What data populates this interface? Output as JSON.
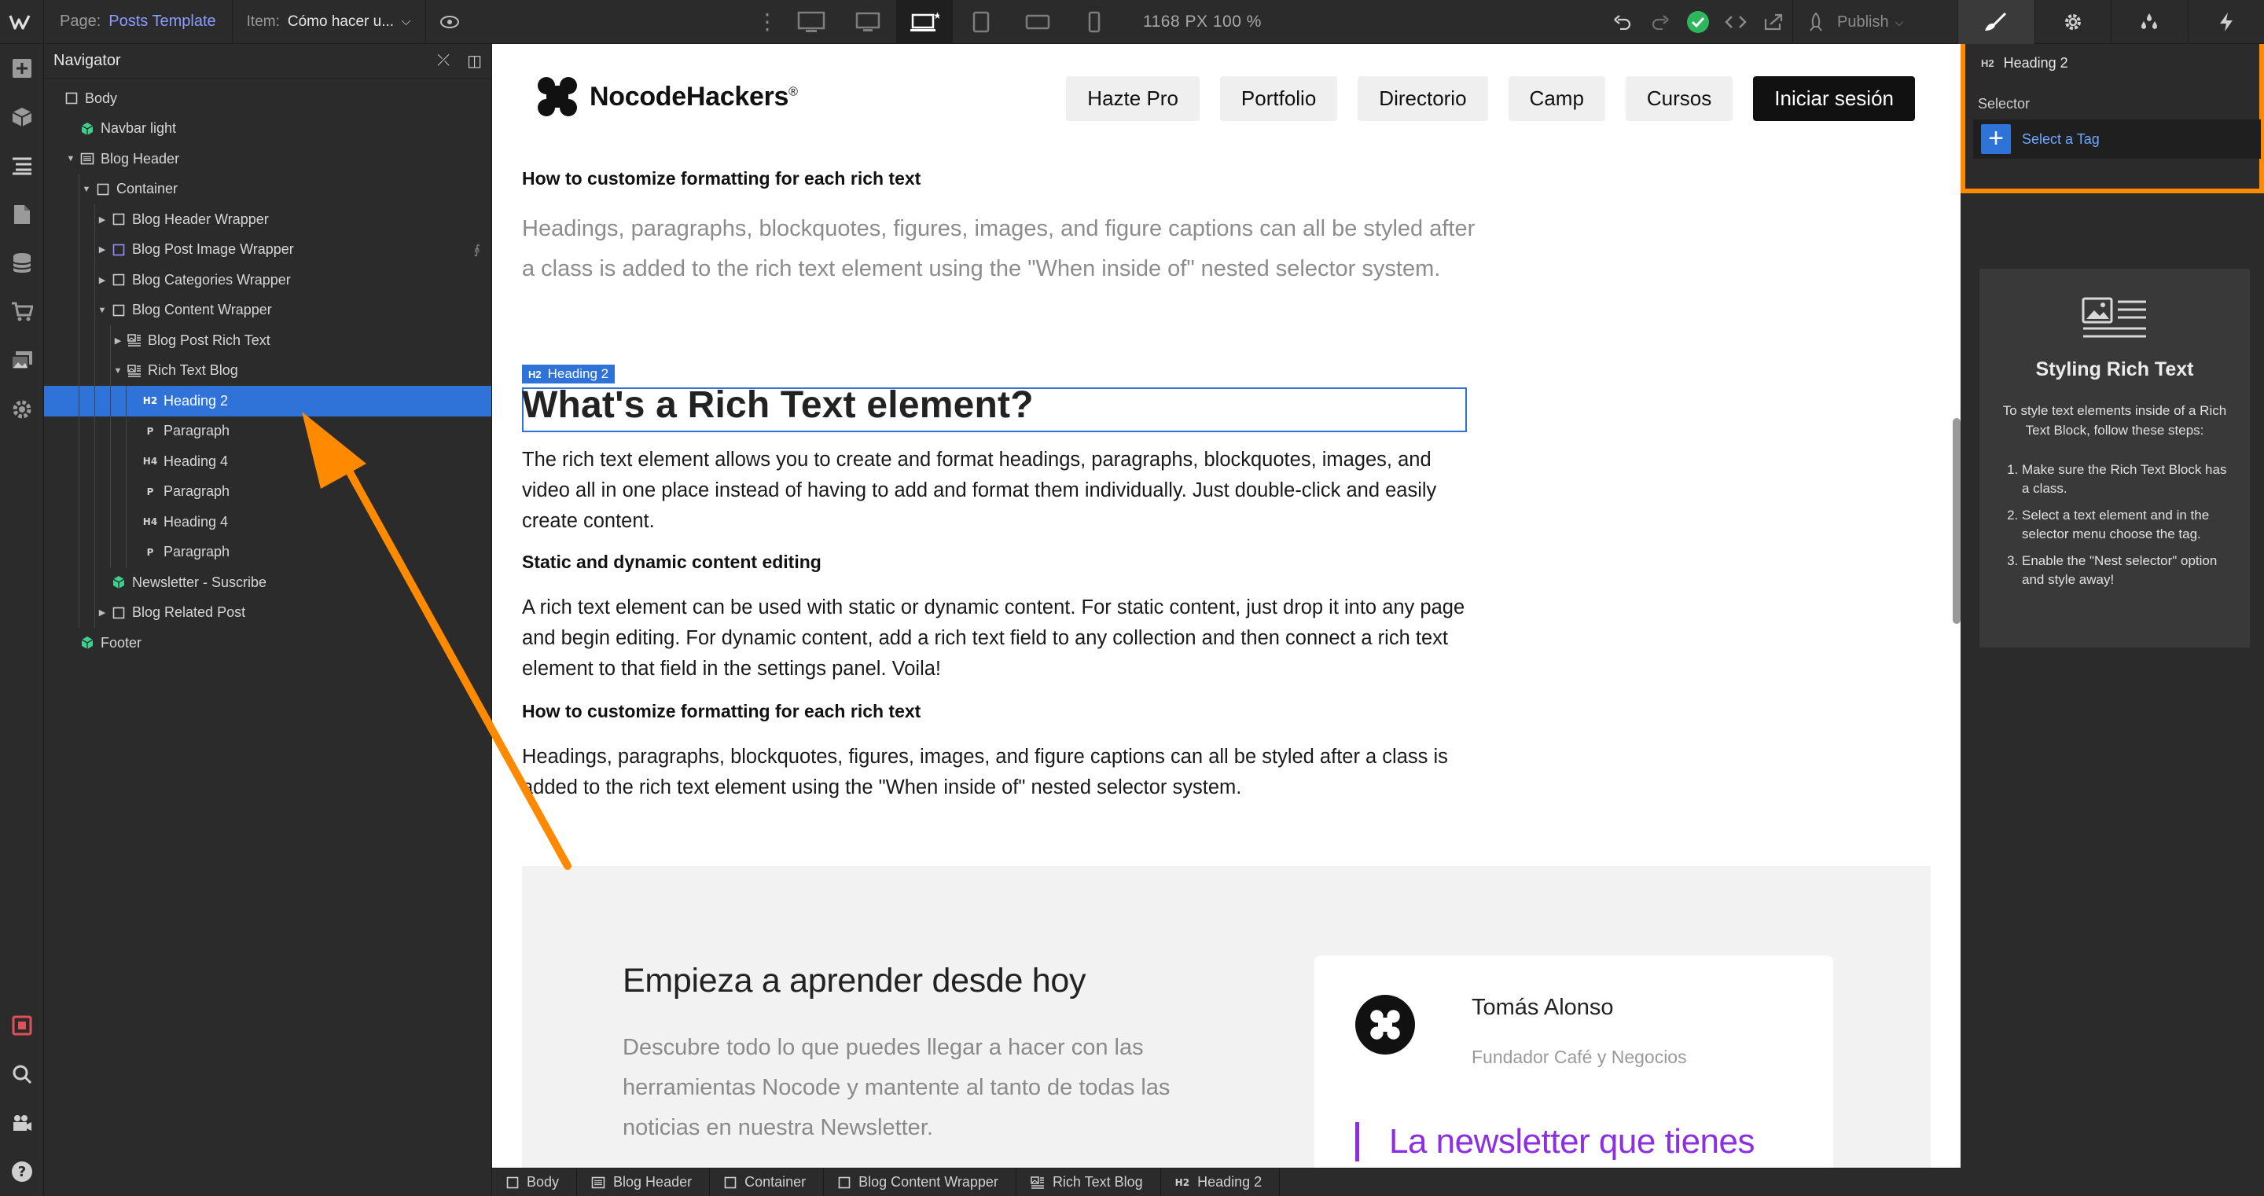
{
  "topbar": {
    "page_label": "Page:",
    "page_value": "Posts Template",
    "item_label": "Item:",
    "item_value": "Cómo hacer u...",
    "size_readout": "1168 PX  100 %",
    "publish_label": "Publish",
    "breakpoints": [
      "desktop-large-icon",
      "desktop-medium-icon",
      "desktop-base-icon",
      "tablet-icon",
      "mobile-landscape-icon",
      "mobile-portrait-icon"
    ]
  },
  "navigator": {
    "title": "Navigator",
    "nodes": [
      {
        "label": "Body",
        "depth": 0,
        "icon": "box",
        "arrow": ""
      },
      {
        "label": "Navbar light",
        "depth": 1,
        "icon": "symbol",
        "arrow": ""
      },
      {
        "label": "Blog Header",
        "depth": 1,
        "icon": "section",
        "arrow": "down"
      },
      {
        "label": "Container",
        "depth": 2,
        "icon": "box",
        "arrow": "down"
      },
      {
        "label": "Blog Header Wrapper",
        "depth": 3,
        "icon": "box",
        "arrow": "right"
      },
      {
        "label": "Blog Post Image Wrapper",
        "depth": 3,
        "icon": "box-purple",
        "arrow": "right"
      },
      {
        "label": "Blog Categories Wrapper",
        "depth": 3,
        "icon": "box",
        "arrow": "right"
      },
      {
        "label": "Blog Content Wrapper",
        "depth": 3,
        "icon": "box",
        "arrow": "down"
      },
      {
        "label": "Blog Post Rich Text",
        "depth": 4,
        "icon": "richtext",
        "arrow": "right"
      },
      {
        "label": "Rich Text Blog",
        "depth": 4,
        "icon": "richtext",
        "arrow": "down"
      },
      {
        "label": "Heading 2",
        "depth": 5,
        "icon": "H2",
        "arrow": ""
      },
      {
        "label": "Paragraph",
        "depth": 5,
        "icon": "P",
        "arrow": ""
      },
      {
        "label": "Heading 4",
        "depth": 5,
        "icon": "H4",
        "arrow": ""
      },
      {
        "label": "Paragraph",
        "depth": 5,
        "icon": "P",
        "arrow": ""
      },
      {
        "label": "Heading 4",
        "depth": 5,
        "icon": "H4",
        "arrow": ""
      },
      {
        "label": "Paragraph",
        "depth": 5,
        "icon": "P",
        "arrow": ""
      },
      {
        "label": "Newsletter - Suscribe",
        "depth": 3,
        "icon": "symbol",
        "arrow": ""
      },
      {
        "label": "Blog Related Post",
        "depth": 3,
        "icon": "box",
        "arrow": "right"
      },
      {
        "label": "Footer",
        "depth": 1,
        "icon": "symbol",
        "arrow": ""
      }
    ]
  },
  "site": {
    "brand": "NocodeHackers",
    "brand_mark": "®",
    "menu": [
      "Hazte Pro",
      "Portfolio",
      "Directorio",
      "Camp",
      "Cursos"
    ],
    "cta": "Iniciar sesión",
    "h6_top": "How to customize formatting for each rich text",
    "lead": "Headings, paragraphs, blockquotes, figures, images, and figure captions can all be styled after a class is added to the rich text element using the \"When inside of\" nested selector system.",
    "h2_tag": "Heading 2",
    "h2": "What's a Rich Text element?",
    "p1": "The rich text element allows you to create and format headings, paragraphs, blockquotes, images, and video all in one place instead of having to add and format them individually. Just double-click and easily create content.",
    "h4_1": "Static and dynamic content editing",
    "p2": "A rich text element can be used with static or dynamic content. For static content, just drop it into any page and begin editing. For dynamic content, add a rich text field to any collection and then connect a rich text element to that field in the settings panel. Voila!",
    "h4_2": "How to customize formatting for each rich text",
    "p3": "Headings, paragraphs, blockquotes, figures, images, and figure captions can all be styled after a class is added to the rich text element using the \"When inside of\" nested selector system.",
    "newsletter": {
      "title": "Empieza a aprender desde hoy",
      "text": "Descubre todo lo que puedes llegar a hacer con las herramientas Nocode y mantente al tanto de todas las noticias en nuestra Newsletter.",
      "author_name": "Tomás Alonso",
      "author_role": "Fundador Café y Negocios",
      "quote": "La newsletter que tienes"
    }
  },
  "breadcrumbs": [
    {
      "label": "Body",
      "icon": "box"
    },
    {
      "label": "Blog Header",
      "icon": "section"
    },
    {
      "label": "Container",
      "icon": "box"
    },
    {
      "label": "Blog Content Wrapper",
      "icon": "box"
    },
    {
      "label": "Rich Text Blog",
      "icon": "richtext"
    },
    {
      "label": "Heading 2",
      "icon": "H2"
    }
  ],
  "style_panel": {
    "element": "Heading 2",
    "element_icon": "H2",
    "selector_label": "Selector",
    "selector_placeholder": "Select a Tag",
    "help_title": "Styling Rich Text",
    "help_desc": "To style text elements inside of a Rich Text Block, follow these steps:",
    "help_steps": [
      "Make sure the Rich Text Block has a class.",
      "Select a text element and in the selector menu choose the tag.",
      "Enable the \"Nest selector\" option and style away!"
    ]
  },
  "colors": {
    "selection_blue": "#2f73d8",
    "annotation_orange": "#ff8a00",
    "quote_purple": "#8b2fe0",
    "symbol_green": "#3ecf8e",
    "status_green": "#2db65c"
  }
}
